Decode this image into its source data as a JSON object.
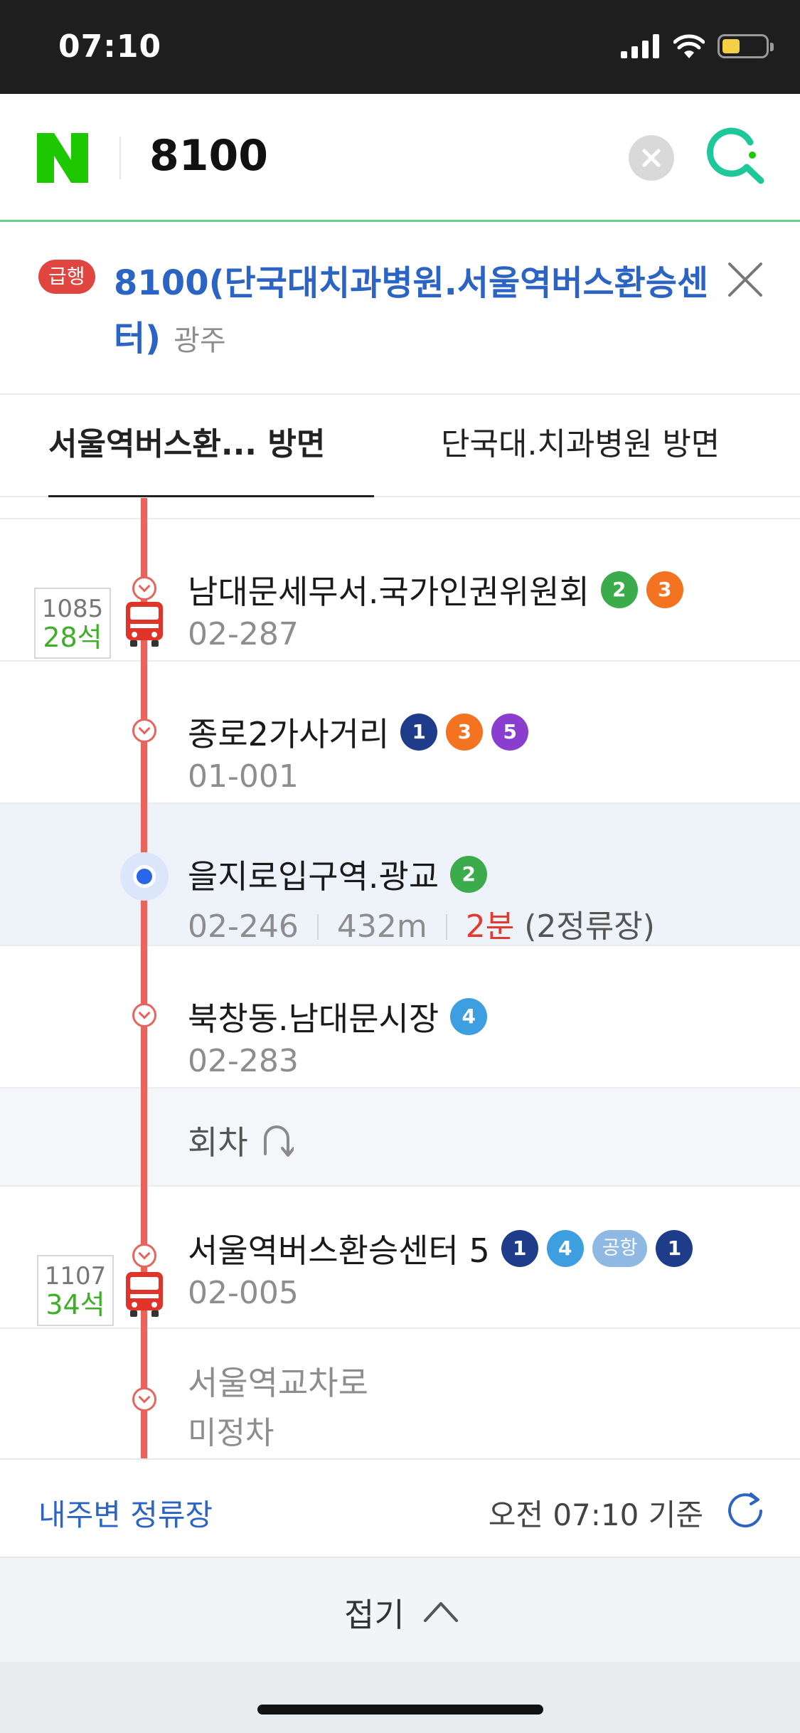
{
  "status_bar": {
    "time": "07:10",
    "battery_level": 0.4
  },
  "search": {
    "query": "8100",
    "logo_letter": "N"
  },
  "route": {
    "badge": "급행",
    "title": "8100(단국대치과병원.서울역버스환승센터)",
    "region": "광주"
  },
  "tabs": [
    {
      "label": "서울역버스환...   방면",
      "active": true
    },
    {
      "label": "단국대.치과병원 방면",
      "active": false
    }
  ],
  "stops": [
    {
      "name": "남대문세무서.국가인권위원회",
      "code": "02-287",
      "lines": [
        {
          "label": "2",
          "color": "#3cab4b"
        },
        {
          "label": "3",
          "color": "#f37321"
        }
      ]
    },
    {
      "name": "종로2가사거리",
      "code": "01-001",
      "lines": [
        {
          "label": "1",
          "color": "#1f3c8a"
        },
        {
          "label": "3",
          "color": "#f37321"
        },
        {
          "label": "5",
          "color": "#8a3ed0"
        }
      ]
    },
    {
      "name": "을지로입구역.광교",
      "code": "02-246",
      "distance": "432m",
      "eta": "2분",
      "remaining": "(2정류장)",
      "lines": [
        {
          "label": "2",
          "color": "#3cab4b"
        }
      ]
    },
    {
      "name": "북창동.남대문시장",
      "code": "02-283",
      "lines": [
        {
          "label": "4",
          "color": "#3d9fe0"
        }
      ]
    },
    {
      "name": "서울역버스환승센터 5",
      "code": "02-005",
      "lines": [
        {
          "label": "1",
          "color": "#1f3c8a"
        },
        {
          "label": "4",
          "color": "#3d9fe0"
        },
        {
          "label": "공항",
          "color": "#8fb8e3"
        },
        {
          "label": "1",
          "color": "#1f3c8a"
        }
      ]
    },
    {
      "name": "서울역교차로",
      "code": "미정차"
    }
  ],
  "turnaround": {
    "label": "회차"
  },
  "buses": [
    {
      "number": "1085",
      "seats": "28석"
    },
    {
      "number": "1107",
      "seats": "34석"
    }
  ],
  "footer": {
    "nearby": "내주변 정류장",
    "updated": "오전 07:10 기준"
  },
  "collapse": {
    "label": "접기"
  },
  "colors": {
    "naver_green": "#1ec800",
    "route_line": "#e8645c",
    "link_blue": "#2b64c4",
    "eta_red": "#e23b2e",
    "seat_green": "#3fae29"
  },
  "icons": [
    "signal-icon",
    "wifi-icon",
    "battery-icon",
    "naver-logo",
    "clear-icon",
    "search-icon",
    "close-icon",
    "stop-marker-icon",
    "bus-icon",
    "turnaround-icon",
    "refresh-icon",
    "chevron-up-icon"
  ]
}
